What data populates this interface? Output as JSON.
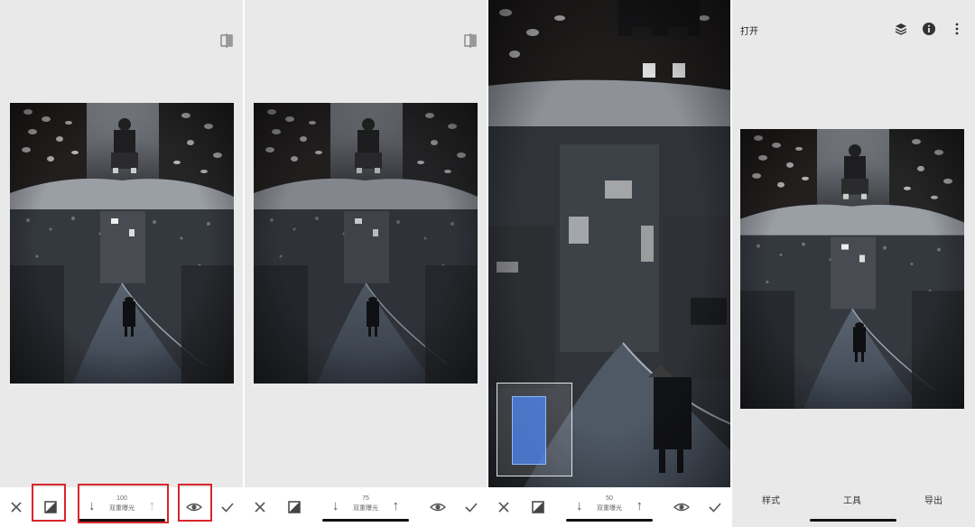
{
  "panels": [
    {
      "id": "p1",
      "slider": {
        "value": "100",
        "label": "双重曝光"
      }
    },
    {
      "id": "p2",
      "slider": {
        "value": "75",
        "label": "双重曝光"
      }
    },
    {
      "id": "p3",
      "slider": {
        "value": "50",
        "label": "双重曝光"
      }
    }
  ],
  "export_screen": {
    "open_label": "打开",
    "tabs": [
      "样式",
      "工具",
      "导出"
    ]
  },
  "icons": {
    "compare": "compare-split-icon",
    "cancel": "close-icon",
    "layer": "layer-blend-icon",
    "decrease": "arrow-down-icon",
    "increase": "arrow-up-icon",
    "visibility": "eye-icon",
    "apply": "checkmark-icon",
    "history": "layers-stack-icon",
    "info": "info-icon",
    "menu": "more-vertical-icon"
  },
  "colors": {
    "highlight": "#d9262c",
    "background": "#e9e9ea",
    "selection": "#508cff"
  }
}
